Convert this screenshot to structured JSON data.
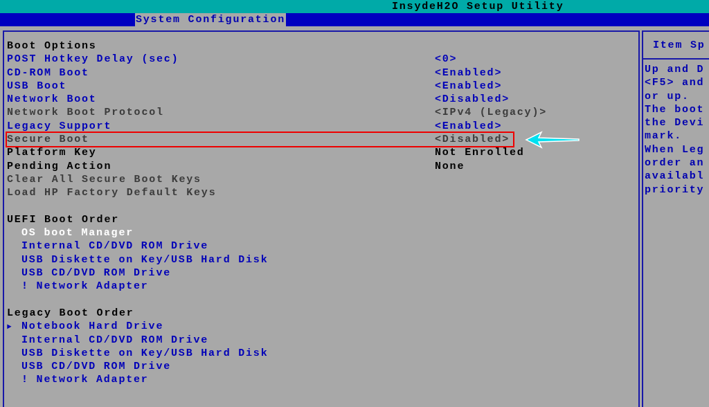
{
  "window": {
    "title": "InsydeH2O Setup Utility"
  },
  "tabs": [
    {
      "label": "System Configuration",
      "selected": true
    }
  ],
  "boot_options": {
    "heading": "Boot Options",
    "rows": [
      {
        "label": "POST Hotkey Delay (sec)",
        "value": "<0>",
        "kind": "editable",
        "highlighted": false
      },
      {
        "label": "CD-ROM Boot",
        "value": "<Enabled>",
        "kind": "editable",
        "highlighted": false
      },
      {
        "label": "USB Boot",
        "value": "<Enabled>",
        "kind": "editable",
        "highlighted": false
      },
      {
        "label": "Network Boot",
        "value": "<Disabled>",
        "kind": "editable",
        "highlighted": false
      },
      {
        "label": "Network Boot Protocol",
        "value": "<IPv4 (Legacy)>",
        "kind": "disabled",
        "highlighted": false
      },
      {
        "label": "Legacy Support",
        "value": "<Enabled>",
        "kind": "editable",
        "highlighted": false
      },
      {
        "label": "Secure Boot",
        "value": "<Disabled>",
        "kind": "disabled",
        "highlighted": true
      },
      {
        "label": "Platform Key",
        "value": "Not Enrolled",
        "kind": "info",
        "highlighted": false
      },
      {
        "label": "Pending Action",
        "value": "None",
        "kind": "info",
        "highlighted": false
      },
      {
        "label": "Clear All Secure Boot Keys",
        "kind": "disabled",
        "highlighted": false
      },
      {
        "label": "Load HP Factory Default Keys",
        "kind": "disabled",
        "highlighted": false
      }
    ]
  },
  "boot_orders": [
    {
      "heading": "UEFI Boot Order",
      "items": [
        {
          "label": "OS boot Manager",
          "selected": true
        },
        {
          "label": "Internal CD/DVD ROM Drive",
          "selected": false
        },
        {
          "label": "USB Diskette on Key/USB Hard Disk",
          "selected": false
        },
        {
          "label": "USB CD/DVD ROM Drive",
          "selected": false
        },
        {
          "label": "! Network Adapter",
          "selected": false
        }
      ]
    },
    {
      "heading": "Legacy Boot Order",
      "items": [
        {
          "label": "Notebook Hard Drive",
          "selected": false,
          "marker": "►"
        },
        {
          "label": "Internal CD/DVD ROM Drive",
          "selected": false
        },
        {
          "label": "USB Diskette on Key/USB Hard Disk",
          "selected": false
        },
        {
          "label": "USB CD/DVD ROM Drive",
          "selected": false
        },
        {
          "label": "! Network Adapter",
          "selected": false
        }
      ]
    }
  ],
  "help_panel": {
    "title": "Item Sp",
    "lines": [
      "Up and D",
      "<F5> and",
      "or up.",
      "The boot",
      "the Devi",
      "mark.",
      "When Leg",
      "order an",
      "availabl",
      "priority"
    ]
  }
}
